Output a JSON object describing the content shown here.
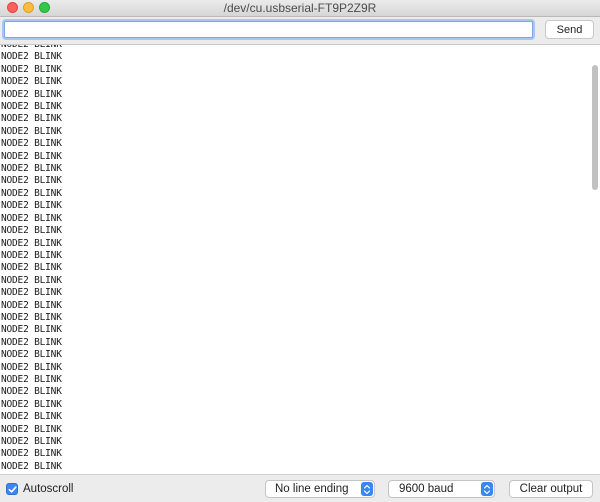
{
  "window": {
    "title": "/dev/cu.usbserial-FT9P2Z9R"
  },
  "toolbar": {
    "input_value": "",
    "send_label": "Send"
  },
  "output": {
    "lines": [
      "NODE2 BLINK",
      "NODE2 BLINK",
      "NODE2 BLINK",
      "NODE2 BLINK",
      "NODE2 BLINK",
      "NODE2 BLINK",
      "NODE2 BLINK",
      "NODE2 BLINK",
      "NODE2 BLINK",
      "NODE2 BLINK",
      "NODE2 BLINK",
      "NODE2 BLINK",
      "NODE2 BLINK",
      "NODE2 BLINK",
      "NODE2 BLINK",
      "NODE2 BLINK",
      "NODE2 BLINK",
      "NODE2 BLINK",
      "NODE2 BLINK",
      "NODE2 BLINK",
      "NODE2 BLINK",
      "NODE2 BLINK",
      "NODE2 BLINK",
      "NODE2 BLINK",
      "NODE2 BLINK",
      "NODE2 BLINK",
      "NODE2 BLINK",
      "NODE2 BLINK",
      "NODE2 BLINK",
      "NODE2 BLINK",
      "NODE2 BLINK",
      "NODE2 BLINK",
      "NODE2 BLINK",
      "NODE2 BLINK",
      "NODE2 BLINK",
      "NODE2 BLINK",
      "NODE2 BLINK",
      "NODE2 BLINK"
    ]
  },
  "footer": {
    "autoscroll_label": "Autoscroll",
    "autoscroll_checked": true,
    "line_ending": "No line ending",
    "baud": "9600 baud",
    "clear_label": "Clear output"
  },
  "colors": {
    "accent": "#3b86f5",
    "close": "#fc605c",
    "minimize": "#fdbc40",
    "maximize": "#34c84a"
  },
  "icons": {
    "checkbox": "checkmark-icon",
    "select": "up-down-chevron-icon"
  }
}
